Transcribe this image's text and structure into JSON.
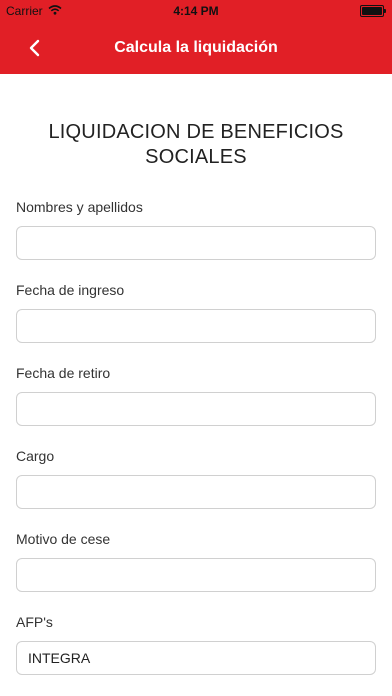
{
  "status_bar": {
    "carrier": "Carrier",
    "time": "4:14 PM"
  },
  "nav": {
    "title": "Calcula la liquidación",
    "back_icon": "chevron-left-icon"
  },
  "form": {
    "title": "LIQUIDACION DE BENEFICIOS SOCIALES",
    "fields": [
      {
        "label": "Nombres y apellidos",
        "value": ""
      },
      {
        "label": "Fecha de ingreso",
        "value": ""
      },
      {
        "label": "Fecha de retiro",
        "value": ""
      },
      {
        "label": "Cargo",
        "value": ""
      },
      {
        "label": "Motivo de cese",
        "value": ""
      },
      {
        "label": "AFP's",
        "value": "INTEGRA"
      }
    ]
  },
  "colors": {
    "brand_red": "#e11f26",
    "background": "#ffffff"
  }
}
